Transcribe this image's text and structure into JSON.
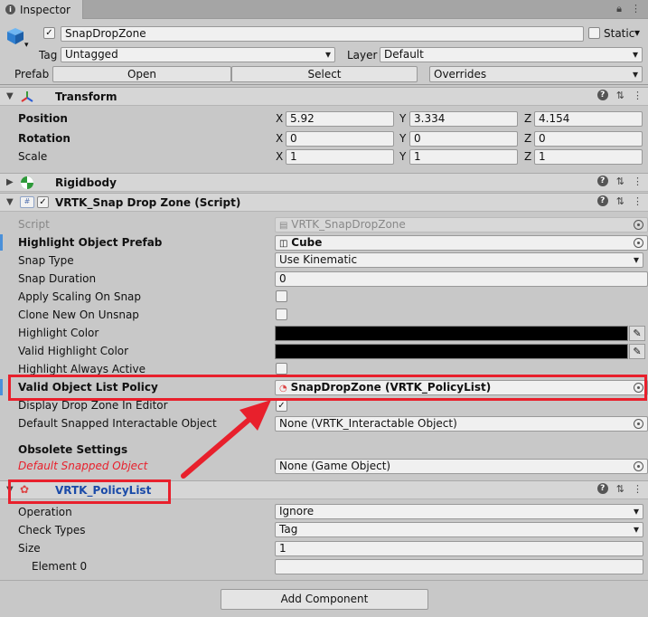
{
  "tab": {
    "title": "Inspector"
  },
  "object": {
    "name": "SnapDropZone",
    "static_label": "Static",
    "tag_label": "Tag",
    "tag_value": "Untagged",
    "layer_label": "Layer",
    "layer_value": "Default",
    "prefab_label": "Prefab",
    "open_label": "Open",
    "select_label": "Select",
    "overrides_label": "Overrides"
  },
  "transform": {
    "title": "Transform",
    "position_label": "Position",
    "rotation_label": "Rotation",
    "scale_label": "Scale",
    "x": "X",
    "y": "Y",
    "z": "Z",
    "position": [
      "5.92",
      "3.334",
      "4.154"
    ],
    "rotation": [
      "0",
      "0",
      "0"
    ],
    "scale": [
      "1",
      "1",
      "1"
    ]
  },
  "rigidbody": {
    "title": "Rigidbody"
  },
  "snapzone": {
    "title": "VRTK_Snap Drop Zone (Script)",
    "script_label": "Script",
    "script_value": "VRTK_SnapDropZone",
    "highlight_prefab_label": "Highlight Object Prefab",
    "highlight_prefab_value": "Cube",
    "snap_type_label": "Snap Type",
    "snap_type_value": "Use Kinematic",
    "snap_duration_label": "Snap Duration",
    "snap_duration_value": "0",
    "apply_scaling_label": "Apply Scaling On Snap",
    "clone_label": "Clone New On Unsnap",
    "highlight_color_label": "Highlight Color",
    "valid_highlight_color_label": "Valid Highlight Color",
    "highlight_always_label": "Highlight Always Active",
    "valid_policy_label": "Valid Object List Policy",
    "valid_policy_value": "SnapDropZone (VRTK_PolicyList)",
    "display_drop_label": "Display Drop Zone In Editor",
    "default_snapped_label": "Default Snapped Interactable Object",
    "default_snapped_value": "None (VRTK_Interactable Object)",
    "obsolete_label": "Obsolete Settings",
    "default_snapped_obj_label": "Default Snapped Object",
    "default_snapped_obj_value": "None (Game Object)"
  },
  "policy": {
    "title": "VRTK_PolicyList",
    "operation_label": "Operation",
    "operation_value": "Ignore",
    "check_types_label": "Check Types",
    "check_types_value": "Tag",
    "size_label": "Size",
    "size_value": "1",
    "element0_label": "Element 0",
    "element0_value": ""
  },
  "add_component_label": "Add Component",
  "colors": {
    "annotation_red": "#e8202c",
    "accent_blue": "#1a4aa8"
  }
}
